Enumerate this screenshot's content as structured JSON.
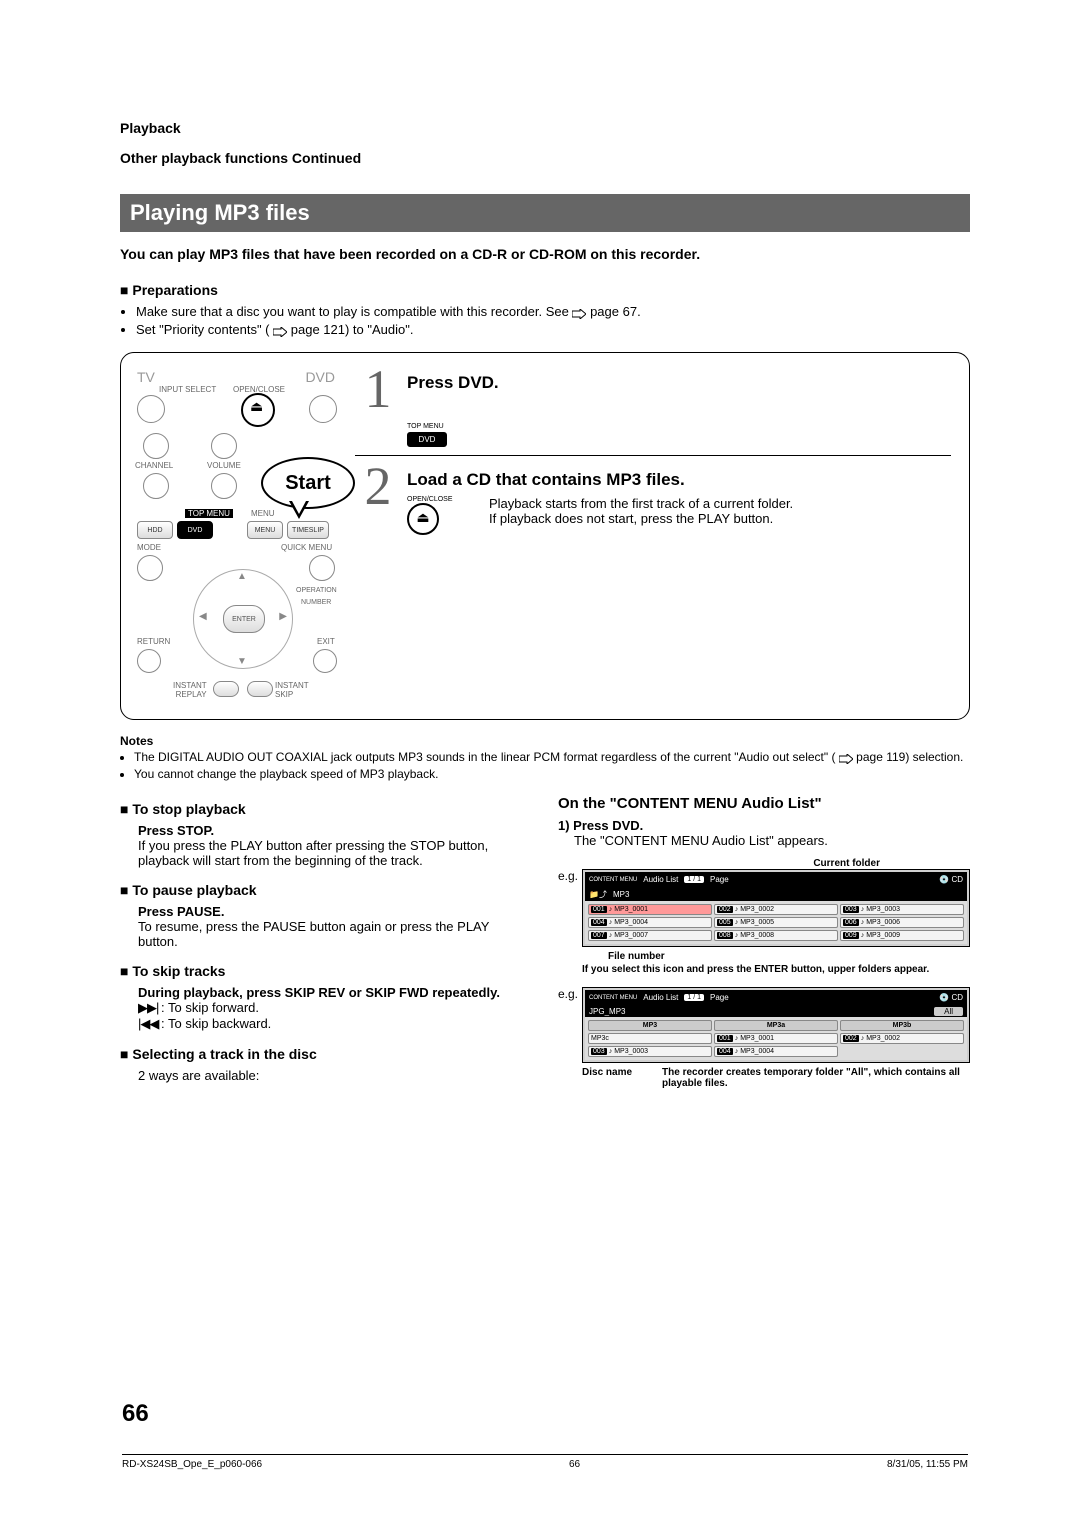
{
  "header": {
    "section": "Playback",
    "continued": "Other playback functions Continued"
  },
  "title": "Playing MP3 files",
  "intro": "You can play MP3 files that have been recorded on a CD-R or CD-ROM on this recorder.",
  "prep": {
    "head": "Preparations",
    "items": [
      "Make sure that a disc you want to play is compatible with this recorder. See",
      "page 67.",
      "Set \"Priority contents\" (",
      "page 121) to \"Audio\"."
    ]
  },
  "remote": {
    "tv": "TV",
    "dvd": "DVD",
    "input_select": "INPUT SELECT",
    "open_close": "OPEN/CLOSE",
    "channel": "CHANNEL",
    "volume": "VOLUME",
    "top_menu": "TOP MENU",
    "menu": "MENU",
    "hdd_btn": "HDD",
    "dvd_btn": "DVD",
    "menu_btn": "MENU",
    "timeslip": "TIMESLIP",
    "mode": "MODE",
    "quick_menu": "QUICK MENU",
    "operation": "OPERATION",
    "number": "NUMBER",
    "enter": "ENTER",
    "return": "RETURN",
    "exit": "EXIT",
    "instant_replay": "INSTANT\nREPLAY",
    "instant_skip": "INSTANT\nSKIP",
    "start": "Start"
  },
  "steps": {
    "s1": {
      "num": "1",
      "title": "Press DVD.",
      "btn_top": "TOP MENU",
      "btn_dvd": "DVD"
    },
    "s2": {
      "num": "2",
      "title": "Load a CD that contains MP3 files.",
      "btn_open": "OPEN/CLOSE",
      "eject": "⏏",
      "text1": "Playback starts from the first track of a current folder.",
      "text2": "If playback does not start, press the PLAY button."
    }
  },
  "notes": {
    "head": "Notes",
    "items": [
      "The DIGITAL AUDIO OUT COAXIAL jack outputs MP3 sounds in the linear PCM format regardless of the current \"Audio out select\" (",
      "page 119) selection.",
      "You cannot change the playback speed of MP3 playback."
    ]
  },
  "left_col": {
    "stop_h": "To stop playback",
    "stop_b": "Press STOP.",
    "stop_t": "If you press the PLAY button after pressing the STOP button, playback will start from the beginning of the track.",
    "pause_h": "To pause playback",
    "pause_b": "Press PAUSE.",
    "pause_t": "To resume, press the PAUSE button again or press the PLAY button.",
    "skip_h": "To skip tracks",
    "skip_b": "During playback, press SKIP REV or SKIP FWD repeatedly.",
    "skip_fwd_icon": "▶▶| ",
    "skip_fwd": ": To skip forward.",
    "skip_bwd_icon": "|◀◀ ",
    "skip_bwd": ": To skip backward.",
    "sel_h": "Selecting a track in the disc",
    "sel_t": "2 ways are available:"
  },
  "right_col": {
    "head": "On the \"CONTENT MENU Audio List\"",
    "step1": "1) Press DVD.",
    "step1_t": "The \"CONTENT MENU Audio List\" appears.",
    "current_folder": "Current folder",
    "eg": "e.g.",
    "menu1": {
      "title_left": "CONTENT MENU",
      "title": "Audio List",
      "page_pill": "1 / 1",
      "page_word": "Page",
      "cd_icon": "CD",
      "folder": "MP3",
      "files": [
        {
          "n": "001",
          "name": "MP3_0001",
          "sel": true
        },
        {
          "n": "002",
          "name": "MP3_0002"
        },
        {
          "n": "003",
          "name": "MP3_0003"
        },
        {
          "n": "004",
          "name": "MP3_0004"
        },
        {
          "n": "005",
          "name": "MP3_0005"
        },
        {
          "n": "006",
          "name": "MP3_0006"
        },
        {
          "n": "007",
          "name": "MP3_0007"
        },
        {
          "n": "008",
          "name": "MP3_0008"
        },
        {
          "n": "009",
          "name": "MP3_0009"
        }
      ]
    },
    "file_number": "File number",
    "icon_note": "If you select this icon and press the ENTER button, upper folders appear.",
    "menu2": {
      "title_left": "CONTENT MENU",
      "title": "Audio List",
      "page_pill": "1 / 1",
      "page_word": "Page",
      "cd_icon": "CD",
      "folder": "JPG_MP3",
      "row1": [
        "MP3",
        "MP3a",
        "MP3b"
      ],
      "row_all_hdr": "All",
      "row2": [
        {
          "n": "",
          "name": "MP3c"
        },
        {
          "n": "001",
          "name": "MP3_0001"
        },
        {
          "n": "002",
          "name": "MP3_0002"
        }
      ],
      "row3": [
        {
          "n": "003",
          "name": "MP3_0003"
        },
        {
          "n": "004",
          "name": "MP3_0004"
        }
      ]
    },
    "disc_name": "Disc name",
    "all_note": "The recorder creates temporary folder \"All\", which contains all playable files."
  },
  "page_number": "66",
  "footer": {
    "left": "RD-XS24SB_Ope_E_p060-066",
    "mid": "66",
    "right": "8/31/05, 11:55 PM"
  }
}
